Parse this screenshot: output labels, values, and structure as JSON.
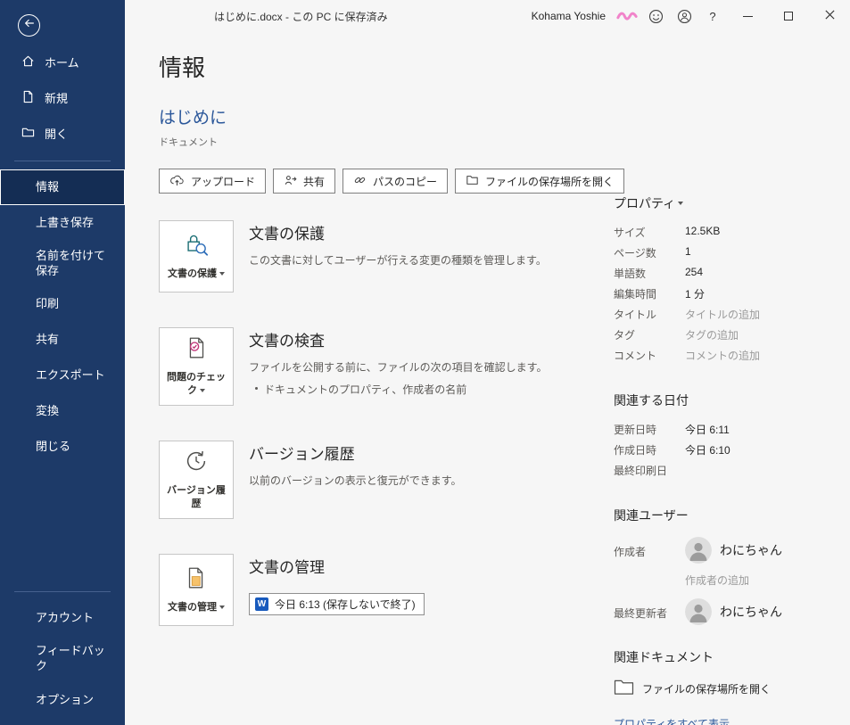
{
  "colors": {
    "sidebar_blue": "#1d3a68",
    "sidebar_selected": "#142d54",
    "accent_blue": "#2b579a",
    "word_icon_blue": "#185abd"
  },
  "titlebar": {
    "document_title": "はじめに.docx - この PC に保存済み",
    "user_name": "Kohama Yoshie",
    "help_label": "?"
  },
  "sidebar": {
    "nav_top": [
      {
        "label": "ホーム"
      },
      {
        "label": "新規"
      },
      {
        "label": "開く"
      }
    ],
    "nav_main": [
      {
        "label": "情報"
      },
      {
        "label": "上書き保存"
      },
      {
        "label": "名前を付けて保存"
      },
      {
        "label": "印刷"
      },
      {
        "label": "共有"
      },
      {
        "label": "エクスポート"
      },
      {
        "label": "変換"
      },
      {
        "label": "閉じる"
      }
    ],
    "nav_bottom": [
      {
        "label": "アカウント"
      },
      {
        "label": "フィードバック"
      },
      {
        "label": "オプション"
      }
    ]
  },
  "main": {
    "page_title": "情報",
    "document_name": "はじめに",
    "document_type": "ドキュメント",
    "toolbar": [
      {
        "label": "アップロード"
      },
      {
        "label": "共有"
      },
      {
        "label": "パスのコピー"
      },
      {
        "label": "ファイルの保存場所を開く"
      }
    ],
    "sections": [
      {
        "button_label": "文書の保護",
        "title": "文書の保護",
        "description": "この文書に対してユーザーが行える変更の種類を管理します。"
      },
      {
        "button_label": "問題のチェック",
        "title": "文書の検査",
        "description": "ファイルを公開する前に、ファイルの次の項目を確認します。",
        "bullet": "ドキュメントのプロパティ、作成者の名前"
      },
      {
        "button_label": "バージョン履歴",
        "title": "バージョン履歴",
        "description": "以前のバージョンの表示と復元ができます。"
      },
      {
        "button_label": "文書の管理",
        "title": "文書の管理",
        "version_entry": "今日 6:13 (保存しないで終了)",
        "word_icon_letter": "W"
      }
    ]
  },
  "properties": {
    "heading": "プロパティ",
    "rows": [
      {
        "label": "サイズ",
        "value": "12.5KB"
      },
      {
        "label": "ページ数",
        "value": "1"
      },
      {
        "label": "単語数",
        "value": "254"
      },
      {
        "label": "編集時間",
        "value": "1 分"
      },
      {
        "label": "タイトル",
        "value": "タイトルの追加"
      },
      {
        "label": "タグ",
        "value": "タグの追加"
      },
      {
        "label": "コメント",
        "value": "コメントの追加"
      }
    ],
    "dates": {
      "heading": "関連する日付",
      "rows": [
        {
          "label": "更新日時",
          "value": "今日 6:11"
        },
        {
          "label": "作成日時",
          "value": "今日 6:10"
        },
        {
          "label": "最終印刷日",
          "value": ""
        }
      ]
    },
    "people": {
      "heading": "関連ユーザー",
      "author_label": "作成者",
      "author_name": "わにちゃん",
      "add_author": "作成者の追加",
      "modifier_label": "最終更新者",
      "modifier_name": "わにちゃん"
    },
    "documents": {
      "heading": "関連ドキュメント",
      "open_location": "ファイルの保存場所を開く"
    },
    "show_all": "プロパティをすべて表示"
  }
}
